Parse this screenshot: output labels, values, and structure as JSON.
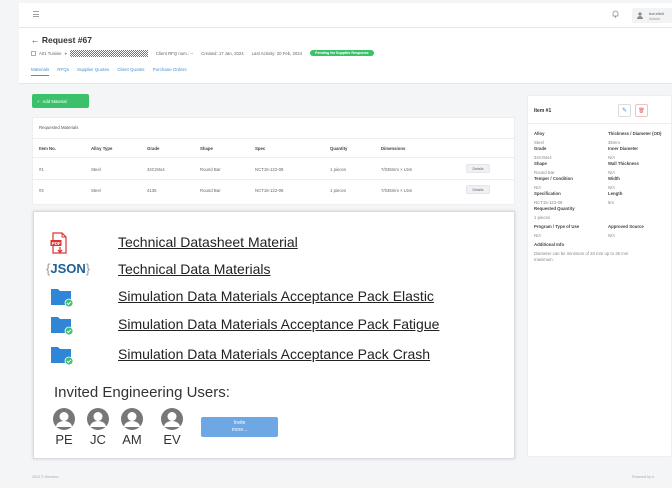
{
  "topbar": {
    "user_name": "bot.elicit",
    "user_role": "Admin"
  },
  "header": {
    "title": "← Request #67",
    "company": "A01 Tunisie",
    "client_rfq": "Client RFQ num.: --",
    "created": "Created: 17 Jan, 2024",
    "last_activity": "Last Activity: 20 Feb, 2024",
    "status": "Pending for Supplier Response",
    "status_color": "#3cc16b",
    "tabs": [
      "Materials",
      "RFQs",
      "Supplier Quotes",
      "Client Quotes",
      "Purchase Orders"
    ]
  },
  "materials": {
    "add_label": "Add Material",
    "card_title": "Requested Materials",
    "columns": [
      "Item No.",
      "Alloy Type",
      "Grade",
      "Shape",
      "Spec",
      "Quantity",
      "Dimensions"
    ],
    "rows": [
      {
        "item": "#1",
        "alloy": "Steel",
        "grade": "34CrMo4",
        "shape": "Round Bar",
        "spec": "NCT15-122-08",
        "qty": "1 pieces",
        "dims": "7/035mm × L5m",
        "action": "Details"
      },
      {
        "item": "#2",
        "alloy": "Steel",
        "grade": "4135",
        "shape": "Round Bar",
        "spec": "NCT15-122-08",
        "qty": "1 pieces",
        "dims": "7/035mm × L5m",
        "action": "Details"
      }
    ]
  },
  "item_panel": {
    "title": "Item #1",
    "fields": [
      {
        "label": "Alloy",
        "value": "Steel"
      },
      {
        "label": "Thickness / Diameter (OD)",
        "value": "35mm"
      },
      {
        "label": "Grade",
        "value": "34CrMo4"
      },
      {
        "label": "Inner Diameter",
        "value": "N/A"
      },
      {
        "label": "Shape",
        "value": "Round Bar"
      },
      {
        "label": "Wall Thickness",
        "value": "N/A"
      },
      {
        "label": "Temper / Condition",
        "value": "N/A"
      },
      {
        "label": "Width",
        "value": "N/A"
      },
      {
        "label": "Specification",
        "value": "NCT15-122-08"
      },
      {
        "label": "Length",
        "value": "5m"
      },
      {
        "label": "Requested Quantity",
        "value": "1 pieces"
      },
      {
        "label": "Program / Type of Use",
        "value": "N/A"
      },
      {
        "label": "Approved Source",
        "value": "N/A"
      },
      {
        "label": "Additional Info",
        "value": "Diameter can be minimum of 33 mm up to 35 mm"
      },
      {
        "label": "",
        "value": "maximum."
      }
    ]
  },
  "overlay": {
    "files": [
      {
        "name": "Technical Datasheet Material",
        "icon": "pdf-icon"
      },
      {
        "name": "Technical Data Materials",
        "icon": "json-icon"
      },
      {
        "name": "Simulation Data Materials Acceptance Pack Elastic",
        "icon": "folder-check-icon"
      },
      {
        "name": "Simulation Data Materials Acceptance Pack Fatigue",
        "icon": "folder-check-icon"
      },
      {
        "name": "Simulation Data Materials Acceptance Pack Crash",
        "icon": "folder-check-icon"
      }
    ],
    "json_label": "JSON",
    "users_title": "Invited Engineering Users:",
    "users": [
      "PE",
      "JC",
      "AM",
      "EV"
    ],
    "invite_line1": "Invite",
    "invite_line2": "more..."
  },
  "footer": {
    "left": "2024 © Mecomo.",
    "right": "Powered by e"
  }
}
